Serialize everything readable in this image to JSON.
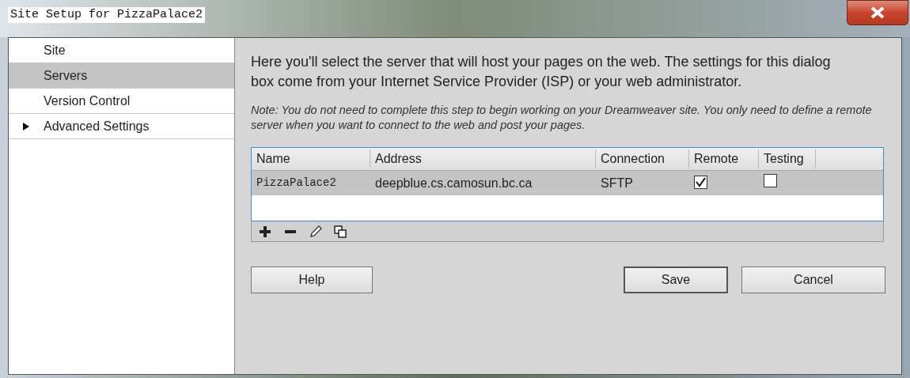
{
  "window": {
    "title": "Site Setup for PizzaPalace2"
  },
  "sidebar": {
    "items": [
      {
        "label": "Site",
        "kind": "page",
        "selected": false
      },
      {
        "label": "Servers",
        "kind": "page",
        "selected": true
      },
      {
        "label": "Version Control",
        "kind": "page",
        "selected": false
      },
      {
        "label": "Advanced Settings",
        "kind": "group",
        "expanded": false,
        "selected": false
      }
    ]
  },
  "intro": "Here you'll select the server that will host your pages on the web. The settings for this dialog box come from your Internet Service Provider (ISP) or your web administrator.",
  "note": "Note: You do not need to complete this step to begin working on your Dreamweaver site. You only need to define a remote server when you want to connect to the web and post your pages.",
  "table": {
    "columns": [
      "Name",
      "Address",
      "Connection",
      "Remote",
      "Testing"
    ],
    "rows": [
      {
        "name": "PizzaPalace2",
        "address": "deepblue.cs.camosun.bc.ca",
        "connection": "SFTP",
        "remote": true,
        "testing": false,
        "selected": true
      }
    ]
  },
  "buttons": [
    {
      "label": "Help",
      "default": false
    },
    {
      "label": "Save",
      "default": true
    },
    {
      "label": "Cancel",
      "default": false
    }
  ]
}
